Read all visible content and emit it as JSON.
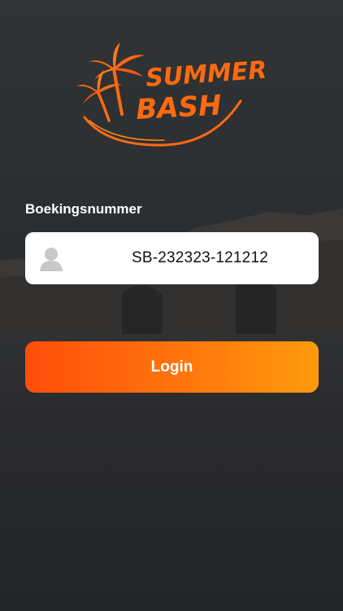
{
  "brand": {
    "line1": "SUMMER",
    "line2": "BASH",
    "accent": "#ff6a10"
  },
  "form": {
    "label": "Boekingsnummer",
    "value": "SB-232323-121212",
    "icon": "user-icon"
  },
  "actions": {
    "login_label": "Login",
    "button_gradient": [
      "#ff4d0a",
      "#ff9a0c"
    ]
  }
}
